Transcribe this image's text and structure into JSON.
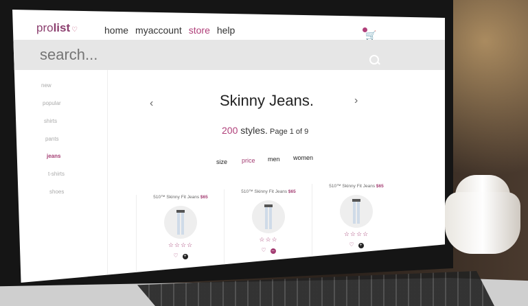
{
  "app": {
    "logo_pro": "pro",
    "logo_list": "list",
    "logo_heart": "♡"
  },
  "nav": {
    "items": [
      {
        "label": "home",
        "active": false
      },
      {
        "label": "myaccount",
        "active": false
      },
      {
        "label": "store",
        "active": true
      },
      {
        "label": "help",
        "active": false
      }
    ]
  },
  "search": {
    "placeholder": "search..."
  },
  "sidebar": {
    "items": [
      {
        "label": "new"
      },
      {
        "label": "popular"
      },
      {
        "label": "shirts"
      },
      {
        "label": "pants"
      },
      {
        "label": "jeans",
        "active": true
      },
      {
        "label": "t-shirts"
      },
      {
        "label": "shoes"
      }
    ]
  },
  "main": {
    "prev": "‹",
    "next": "›",
    "title": "Skinny Jeans.",
    "count_num": "200",
    "count_text": " styles.",
    "page_text": " Page 1 of 9",
    "filters": [
      {
        "label": "size"
      },
      {
        "label": "price",
        "active": true
      },
      {
        "label": "men"
      },
      {
        "label": "women"
      }
    ]
  },
  "products": [
    {
      "name": "510™ Skinny Fit Jeans ",
      "price": "$65",
      "stars": "☆☆☆☆",
      "heart": "♡",
      "add": "+"
    },
    {
      "name": "510™ Skinny Fit Jeans ",
      "price": "$65",
      "stars": "☆☆☆",
      "heart": "♡",
      "add": "–"
    },
    {
      "name": "510™ Skinny Fit Jeans ",
      "price": "$65",
      "stars": "☆☆☆☆",
      "heart": "♡",
      "add": "+"
    }
  ],
  "colors": {
    "accent": "#a33c72",
    "searchbar": "#e6e6e6"
  }
}
